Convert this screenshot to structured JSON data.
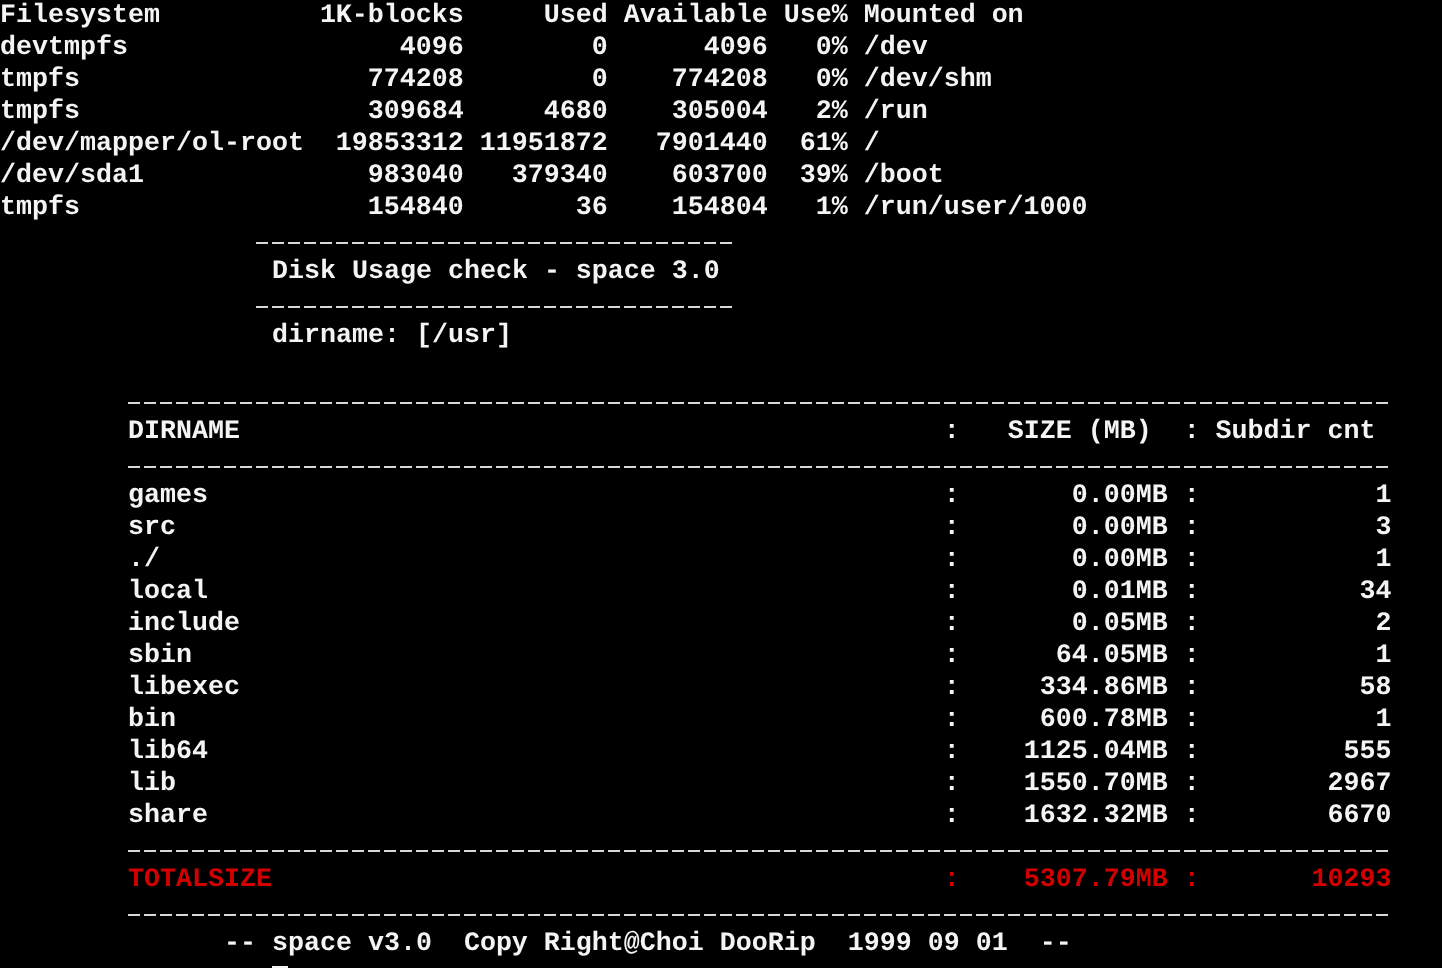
{
  "filesystem_table": {
    "columns": [
      "Filesystem",
      "1K-blocks",
      "Used",
      "Available",
      "Use%",
      "Mounted on"
    ],
    "rows": [
      [
        "devtmpfs",
        "4096",
        "0",
        "4096",
        "0%",
        "/dev"
      ],
      [
        "tmpfs",
        "774208",
        "0",
        "774208",
        "0%",
        "/dev/shm"
      ],
      [
        "tmpfs",
        "309684",
        "4680",
        "305004",
        "2%",
        "/run"
      ],
      [
        "/dev/mapper/ol-root",
        "19853312",
        "11951872",
        "7901440",
        "61%",
        "/"
      ],
      [
        "/dev/sda1",
        "983040",
        "379340",
        "603700",
        "39%",
        "/boot"
      ],
      [
        "tmpfs",
        "154840",
        "36",
        "154804",
        "1%",
        "/run/user/1000"
      ]
    ]
  },
  "banner": {
    "title": "Disk Usage check - space 3.0",
    "dirname": "dirname: [/usr]"
  },
  "usage_table": {
    "header": [
      "DIRNAME",
      ":",
      "SIZE (MB)",
      ":",
      "Subdir cnt"
    ],
    "rows": [
      {
        "cells": [
          "games",
          ":",
          "0.00MB",
          ":",
          "1"
        ]
      },
      {
        "cells": [
          "src",
          ":",
          "0.00MB",
          ":",
          "3"
        ]
      },
      {
        "cells": [
          "./",
          ":",
          "0.00MB",
          ":",
          "1"
        ]
      },
      {
        "cells": [
          "local",
          ":",
          "0.01MB",
          ":",
          "34"
        ]
      },
      {
        "cells": [
          "include",
          ":",
          "0.05MB",
          ":",
          "2"
        ]
      },
      {
        "cells": [
          "sbin",
          ":",
          "64.05MB",
          ":",
          "1"
        ]
      },
      {
        "cells": [
          "libexec",
          ":",
          "334.86MB",
          ":",
          "58"
        ]
      },
      {
        "cells": [
          "bin",
          ":",
          "600.78MB",
          ":",
          "1"
        ]
      },
      {
        "cells": [
          "lib64",
          ":",
          "1125.04MB",
          ":",
          "555"
        ]
      },
      {
        "cells": [
          "lib",
          ":",
          "1550.70MB",
          ":",
          "2967"
        ]
      },
      {
        "cells": [
          "share",
          ":",
          "1632.32MB",
          ":",
          "6670"
        ]
      }
    ],
    "total": {
      "cells": [
        "TOTALSIZE",
        ":",
        "5307.79MB",
        ":",
        "10293"
      ]
    }
  },
  "footer": "-- space v3.0  Copy Right@Choi DooRip  1999 09 01  --"
}
